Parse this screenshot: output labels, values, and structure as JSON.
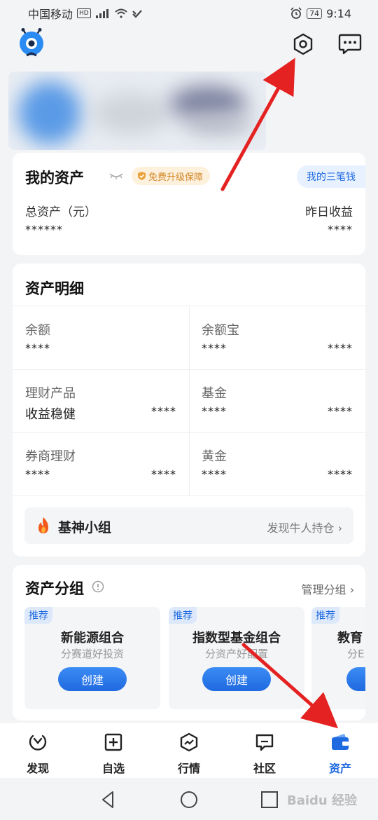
{
  "status": {
    "carrier": "中国移动",
    "hd": "HD",
    "battery": "74",
    "time": "9:14"
  },
  "assets": {
    "title": "我的资产",
    "badge": "免费升级保障",
    "three_money": "我的三笔钱",
    "total_label": "总资产（元）",
    "total_value": "******",
    "yesterday_label": "昨日收益",
    "yesterday_value": "****"
  },
  "detail": {
    "title": "资产明细",
    "cells": [
      {
        "label": "余额",
        "value": "****"
      },
      {
        "label": "余额宝",
        "value": "****"
      },
      {
        "label": "理财产品",
        "sub": "收益稳健",
        "value": "****"
      },
      {
        "label": "基金",
        "value": "****",
        "value2": "****"
      },
      {
        "label": "券商理财",
        "value": "****",
        "value2": "****"
      },
      {
        "label": "黄金",
        "value": "****",
        "value2": "****"
      }
    ],
    "yuebao_value2": "****",
    "group": {
      "name": "基神小组",
      "link": "发现牛人持仓"
    }
  },
  "groups": {
    "title": "资产分组",
    "manage": "管理分组",
    "cards": [
      {
        "tag": "推荐",
        "name": "新能源组合",
        "desc": "分赛道好投资",
        "button": "创建"
      },
      {
        "tag": "推荐",
        "name": "指数型基金组合",
        "desc": "分资产好配置",
        "button": "创建"
      },
      {
        "tag": "推荐",
        "name": "教育",
        "desc": "分E",
        "button": ""
      }
    ]
  },
  "tabs": [
    {
      "label": "发现"
    },
    {
      "label": "自选"
    },
    {
      "label": "行情"
    },
    {
      "label": "社区"
    },
    {
      "label": "资产"
    }
  ],
  "colors": {
    "accent": "#1f6ae0",
    "arrow": "#e52222",
    "badge": "#d48a2c"
  },
  "watermark": "Baidu 经验"
}
